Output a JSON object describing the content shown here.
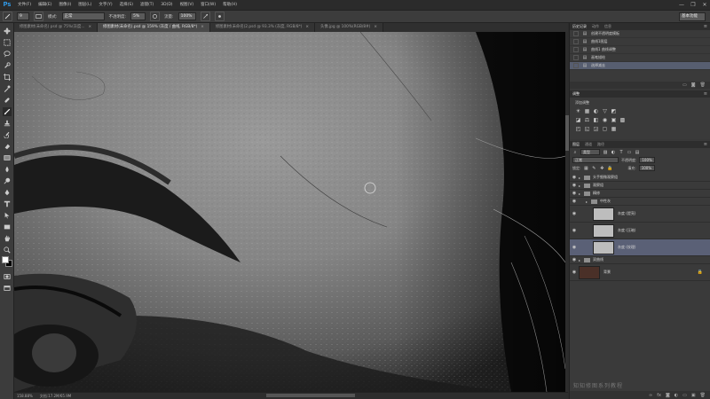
{
  "app": {
    "logo": "Ps"
  },
  "menu": [
    "文件(F)",
    "编辑(E)",
    "图像(I)",
    "图层(L)",
    "文字(Y)",
    "选择(S)",
    "滤镜(T)",
    "3D(D)",
    "视图(V)",
    "窗口(W)",
    "帮助(H)"
  ],
  "window_controls": [
    "—",
    "❐",
    "✕"
  ],
  "options": {
    "tool_icon": "brush-icon",
    "size_value": "9",
    "mode_label": "模式:",
    "mode_value": "正常",
    "opacity_label": "不透明度:",
    "opacity_value": "5%",
    "flow_label": "流量:",
    "flow_value": "100%",
    "workspace": "基本功能"
  },
  "doc_tabs": [
    {
      "label": "修图素材(未命名) psd @ 75%(灰度...",
      "active": false
    },
    {
      "label": "修图素材(未命名).psd @ 159% (灰度 / 曲线, RGB/8*)",
      "active": true
    },
    {
      "label": "修图素材(未命名)2.psd @ 93.3% (灰度, RGB/8*)",
      "active": false
    },
    {
      "label": "头像.jpg @ 100%(RGB/8#)",
      "active": false
    }
  ],
  "status": {
    "zoom": "158.88%",
    "doc": "文档:17.2M/65.9M"
  },
  "history": {
    "tabs": [
      "历史记录",
      "动作",
      "信息"
    ],
    "rows": [
      {
        "label": "创建不透明度模板",
        "active": false
      },
      {
        "label": "曲线1图层",
        "active": false
      },
      {
        "label": "曲线1 曲线调整",
        "active": false
      },
      {
        "label": "画笔描绘",
        "active": false
      },
      {
        "label": "选择减去",
        "active": true
      }
    ]
  },
  "adjustments": {
    "tabs": [
      "调整"
    ],
    "title": "添加调整",
    "row1": [
      "☀",
      "▦",
      "◐",
      "▽",
      "◩"
    ],
    "row2": [
      "◪",
      "⚖",
      "◧",
      "◉",
      "▣",
      "▩"
    ],
    "row3": [
      "◰",
      "◱",
      "◲",
      "▢",
      "▦"
    ]
  },
  "layers": {
    "tabs": [
      "图层",
      "通道",
      "路径"
    ],
    "filter_label": "类型",
    "blend_mode": "正常",
    "opacity_label": "不透明度:",
    "opacity_value": "100%",
    "lock_label": "锁定:",
    "fill_label": "填充:",
    "fill_value": "100%",
    "items": [
      {
        "name": "头手细微观察组",
        "type": "group",
        "indent": 0,
        "active": false
      },
      {
        "name": "观察组",
        "type": "group",
        "indent": 0,
        "active": false
      },
      {
        "name": "精修",
        "type": "group",
        "indent": 0,
        "active": false
      },
      {
        "name": "中性灰",
        "type": "group",
        "indent": 1,
        "active": false
      },
      {
        "name": "灰度 (提亮)",
        "type": "layer",
        "indent": 2,
        "active": false
      },
      {
        "name": "灰度 (压暗)",
        "type": "layer",
        "indent": 2,
        "active": false
      },
      {
        "name": "灰度 (纹理)",
        "type": "layer",
        "indent": 2,
        "active": true
      },
      {
        "name": "双曲线",
        "type": "group",
        "indent": 0,
        "active": false
      },
      {
        "name": "背景",
        "type": "layer-dark",
        "indent": 0,
        "active": false,
        "locked": true
      }
    ]
  },
  "watermark": "知知修图系列教程"
}
